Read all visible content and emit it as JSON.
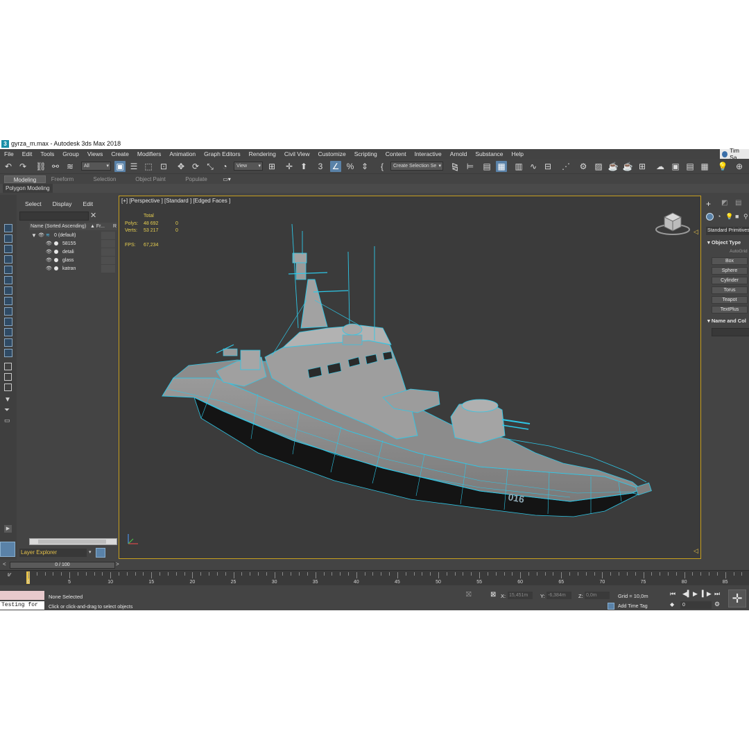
{
  "window": {
    "title": "gyrza_m.max - Autodesk 3ds Max 2018",
    "app_icon": "3",
    "user": "Tim Sa"
  },
  "menu": [
    "File",
    "Edit",
    "Tools",
    "Group",
    "Views",
    "Create",
    "Modifiers",
    "Animation",
    "Graph Editors",
    "Rendering",
    "Civil View",
    "Customize",
    "Scripting",
    "Content",
    "Interactive",
    "Arnold",
    "Substance",
    "Help"
  ],
  "toolbar": {
    "filter_value": "All",
    "refcoord_value": "View",
    "selection_set_placeholder": "Create Selection Se"
  },
  "ribbon": {
    "tabs": [
      "Modeling",
      "Freeform",
      "Selection",
      "Object Paint",
      "Populate"
    ],
    "active_tab": "Modeling",
    "panel_label": "Polygon Modeling"
  },
  "explorer": {
    "menu": [
      "Select",
      "Display",
      "Edit"
    ],
    "column_name": "Name (Sorted Ascending)",
    "column_frozen": "▲ Fr...",
    "column_r": "R",
    "layers": [
      {
        "name": "0 (default)",
        "type": "layer"
      },
      {
        "name": "58155",
        "type": "object"
      },
      {
        "name": "detali",
        "type": "object"
      },
      {
        "name": "glass",
        "type": "object"
      },
      {
        "name": "katran",
        "type": "object"
      }
    ],
    "layer_explorer_label": "Layer Explorer"
  },
  "viewport": {
    "label": "[+] [Perspective ] [Standard ] [Edged Faces ]",
    "stats": {
      "header": "Total",
      "polys_label": "Polys:",
      "polys_total": "48 692",
      "polys_sel": "0",
      "verts_label": "Verts:",
      "verts_total": "53 217",
      "verts_sel": "0",
      "fps_label": "FPS:",
      "fps_value": "67,234"
    },
    "hull_number": "016"
  },
  "command_panel": {
    "category": "Standard Primitives",
    "object_type_header": "Object Type",
    "autogrid": "AutoGrid",
    "buttons": [
      "Box",
      "Sphere",
      "Cylinder",
      "Torus",
      "Teapot",
      "TextPlus"
    ],
    "name_color_header": "Name and Col"
  },
  "timeline": {
    "slider_label": "0 / 100",
    "ticks": [
      "0",
      "5",
      "10",
      "15",
      "20",
      "25",
      "30",
      "35",
      "40",
      "45",
      "50",
      "55",
      "60",
      "65",
      "70",
      "75",
      "80",
      "85"
    ]
  },
  "status": {
    "listener_text": "Testing for :",
    "selection": "None Selected",
    "prompt": "Click or click-and-drag to select objects",
    "x_label": "X:",
    "x_value": "15,451m",
    "y_label": "Y:",
    "y_value": "-6,384m",
    "z_label": "Z:",
    "z_value": "0,0m",
    "grid": "Grid = 10,0m",
    "add_time_tag": "Add Time Tag",
    "frame_value": "0"
  },
  "colors": {
    "wire": "#2ec8e8",
    "hull_grey": "#8e8e8e",
    "viewport_border": "#c8a01e",
    "stats_text": "#e8d050"
  }
}
